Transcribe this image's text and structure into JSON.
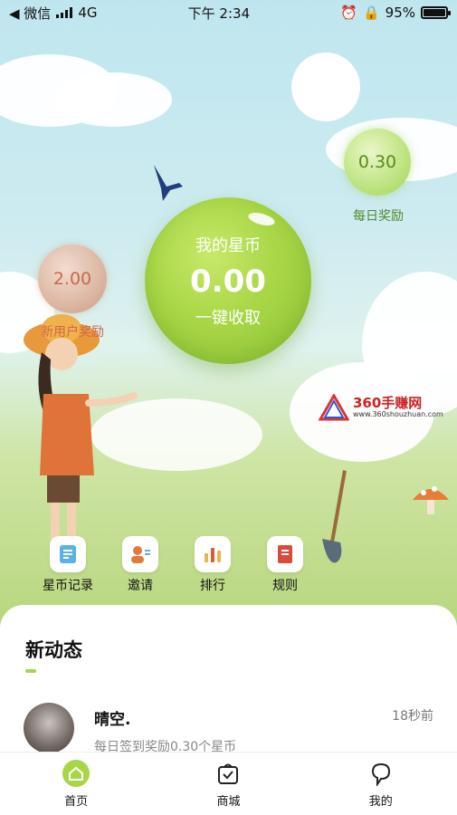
{
  "status_bar": {
    "carrier": "◀ 微信",
    "network": "4G",
    "time": "下午 2:34",
    "battery": "95%"
  },
  "rewards": {
    "daily": {
      "value": "0.30",
      "label": "每日奖励"
    },
    "newbie": {
      "value": "2.00",
      "label": "新用户奖励"
    }
  },
  "main_ball": {
    "label": "我的星币",
    "value": "0.00",
    "action": "一键收取"
  },
  "watermark": {
    "title": "360手赚网",
    "url": "www.360shouzhuan.com"
  },
  "quick_menu": [
    {
      "label": "星币记录",
      "icon": "record-icon"
    },
    {
      "label": "邀请",
      "icon": "invite-icon"
    },
    {
      "label": "排行",
      "icon": "ranking-icon"
    },
    {
      "label": "规则",
      "icon": "rules-icon"
    }
  ],
  "feed": {
    "title": "新动态",
    "items": [
      {
        "name": "晴空.",
        "time": "18秒前",
        "desc": "每日签到奖励0.30个星币"
      }
    ]
  },
  "tabbar": [
    {
      "label": "首页",
      "icon": "home-icon",
      "active": true
    },
    {
      "label": "商城",
      "icon": "shop-icon",
      "active": false
    },
    {
      "label": "我的",
      "icon": "profile-icon",
      "active": false
    }
  ],
  "colors": {
    "accent": "#a8d646",
    "sky": "#bfe6ef",
    "grass": "#b7d67c"
  }
}
